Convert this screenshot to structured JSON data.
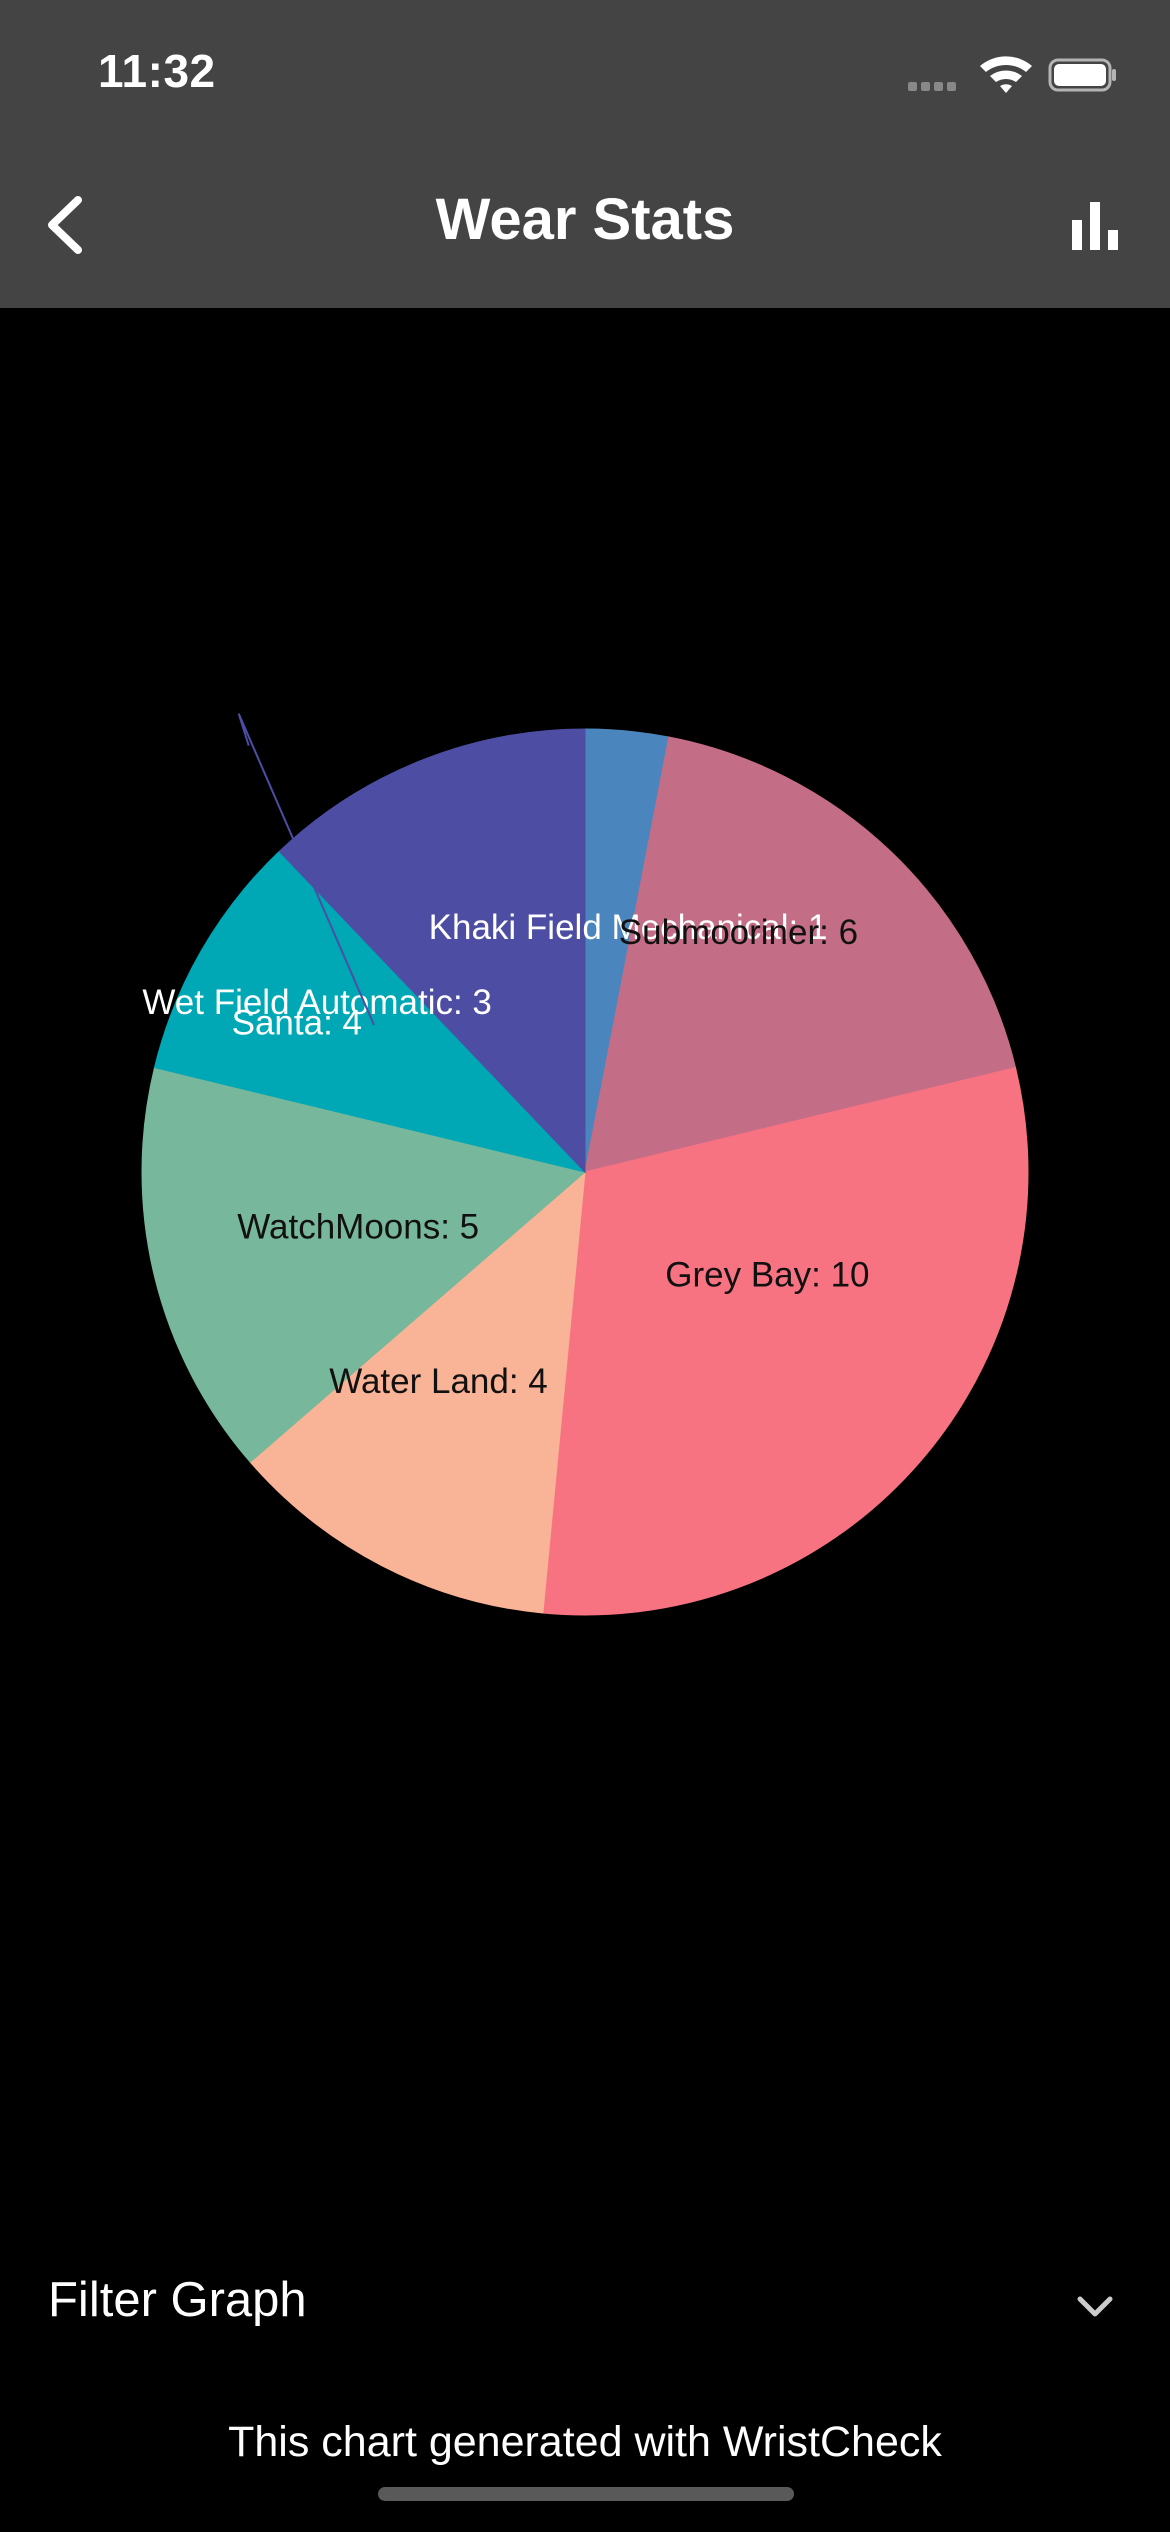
{
  "status_bar": {
    "time": "11:32",
    "icons": [
      "signal-icon",
      "wifi-icon",
      "battery-icon"
    ]
  },
  "nav": {
    "title": "Wear Stats",
    "back_icon": "chevron-left-icon",
    "stats_icon": "bar-chart-icon"
  },
  "colors": {
    "header_bg": "#444444",
    "background": "#000000"
  },
  "chart_data": {
    "type": "pie",
    "start_angle_deg": 0,
    "direction": "clockwise",
    "slices": [
      {
        "label": "Khaki Field Mechanical",
        "value": 1,
        "color": "#4A86BD",
        "text": "Khaki Field Mechanical: 1",
        "label_color": "#ffffff"
      },
      {
        "label": "Submooriner",
        "value": 6,
        "color": "#C46D86",
        "text": "Submooriner: 6",
        "label_color": "#111111"
      },
      {
        "label": "Grey Bay",
        "value": 10,
        "color": "#F77382",
        "text": "Grey Bay: 10",
        "label_color": "#111111"
      },
      {
        "label": "Water Land",
        "value": 4,
        "color": "#F9B396",
        "text": "Water Land: 4",
        "label_color": "#111111"
      },
      {
        "label": "WatchMoons",
        "value": 5,
        "color": "#77B79B",
        "text": "WatchMoons: 5",
        "label_color": "#111111"
      },
      {
        "label": "Wet Field Automatic",
        "value": 3,
        "color": "#00A7B5",
        "text": "Wet Field Automatic: 3",
        "label_color": "#ffffff"
      },
      {
        "label": "Santa",
        "value": 4,
        "color": "#4D4EA3",
        "text": "Santa: 4",
        "label_color": "#ffffff"
      }
    ]
  },
  "filter": {
    "label": "Filter Graph",
    "icon": "chevron-down-icon"
  },
  "footer": {
    "text": "This chart generated with WristCheck"
  }
}
